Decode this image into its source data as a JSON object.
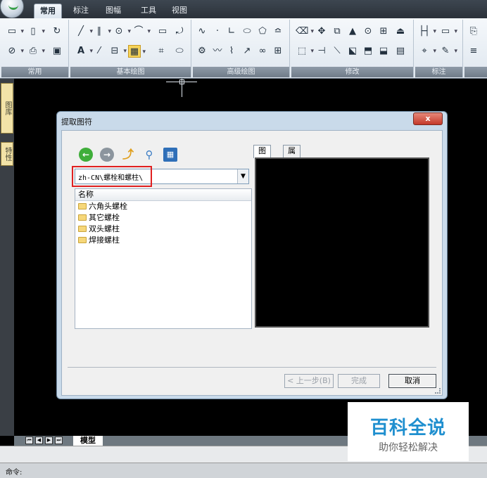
{
  "ribbon": {
    "tabs": [
      "常用",
      "标注",
      "图幅",
      "工具",
      "视图"
    ],
    "groups": [
      "常用",
      "基本绘图",
      "高级绘图",
      "修改",
      "标注"
    ]
  },
  "side_tabs": [
    "图库",
    "特性"
  ],
  "dialog": {
    "title": "提取图符",
    "close": "x",
    "path": "zh-CN\\螺栓和螺柱\\",
    "list_header": "名称",
    "items": [
      "六角头螺栓",
      "其它螺栓",
      "双头螺柱",
      "焊接螺柱"
    ],
    "tabs": [
      "图形",
      "属性"
    ],
    "buttons": {
      "back": "< 上一步(B)",
      "finish": "完成",
      "cancel": "取消"
    }
  },
  "layout": {
    "model_tab": "模型"
  },
  "command": {
    "prompt": "命令:"
  },
  "watermark": {
    "title": "百科全说",
    "subtitle": "助你轻松解决"
  },
  "colors": {
    "accent": "#1f8fcf",
    "highlight": "#e02020",
    "background": "#000000"
  }
}
